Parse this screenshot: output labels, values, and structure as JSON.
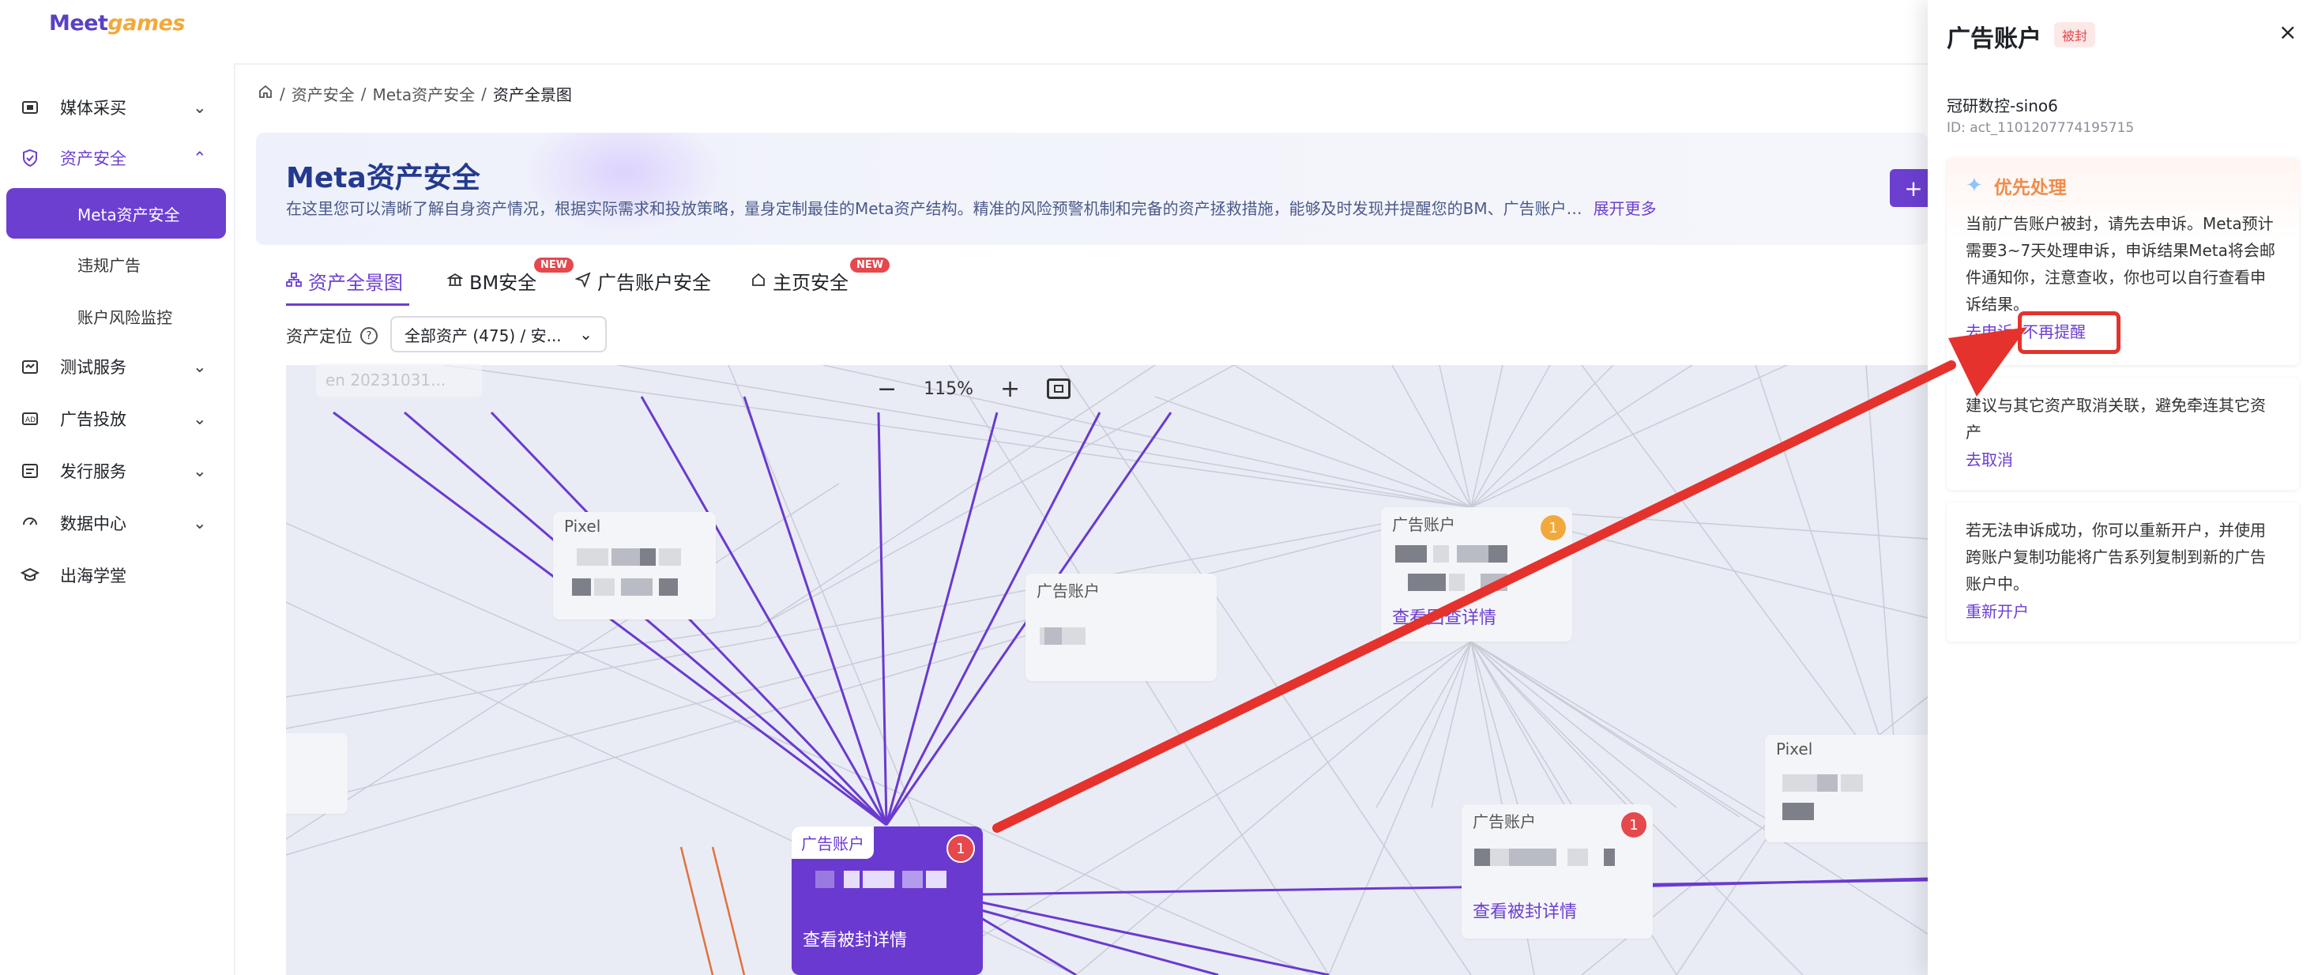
{
  "app": {
    "logo_part1": "Meet",
    "logo_part2": "games"
  },
  "sidebar": {
    "items": [
      {
        "label": "媒体采买",
        "icon": "media-icon"
      },
      {
        "label": "资产安全",
        "icon": "shield-icon"
      },
      {
        "label": "测试服务",
        "icon": "test-icon"
      },
      {
        "label": "广告投放",
        "icon": "ad-icon"
      },
      {
        "label": "发行服务",
        "icon": "publish-icon"
      },
      {
        "label": "数据中心",
        "icon": "data-icon"
      },
      {
        "label": "出海学堂",
        "icon": "school-icon"
      }
    ],
    "sub_items": [
      "Meta资产安全",
      "违规广告",
      "账户风险监控"
    ]
  },
  "breadcrumb": {
    "items": [
      "资产安全",
      "Meta资产安全"
    ],
    "current": "资产全景图"
  },
  "banner": {
    "title": "Meta资产安全",
    "description": "在这里您可以清晰了解自身资产情况，根据实际需求和投放策略，量身定制最佳的Meta资产结构。精准的风险预警机制和完备的资产拯救措施，能够及时发现并提醒您的BM、广告账户…",
    "more": "展开更多",
    "button_plus": "+"
  },
  "tabs": [
    {
      "label": "资产全景图",
      "badge": ""
    },
    {
      "label": "BM安全",
      "badge": "NEW"
    },
    {
      "label": "广告账户安全",
      "badge": ""
    },
    {
      "label": "主页安全",
      "badge": "NEW"
    }
  ],
  "filter": {
    "label": "资产定位",
    "value": "全部资产 (475) / 安..."
  },
  "graph": {
    "zoom": "115%",
    "ghost_text": "en 20231031...",
    "nodes": [
      {
        "label": "Pixel"
      },
      {
        "label": "广告账户"
      },
      {
        "label": "广告账户",
        "badge": "1",
        "link": "查看回查详情"
      },
      {
        "label": "广告账户",
        "badge": "1",
        "link": "查看被封详情"
      },
      {
        "label": "广告账户",
        "badge": "1",
        "link": "查看被封详情"
      },
      {
        "label": "Pixel"
      }
    ]
  },
  "drawer": {
    "title": "广告账户",
    "status": "被封",
    "close": "×",
    "account_name": "冠研数控-sino6",
    "account_id": "ID: act_1101207774195715",
    "priority": {
      "title": "优先处理",
      "text": "当前广告账户被封，请先去申诉。Meta预计需要3~7天处理申诉，申诉结果Meta将会邮件通知你，注意查收，你也可以自行查看申诉结果。",
      "action1": "去申诉",
      "action2": "不再提醒"
    },
    "cancel_card": {
      "text": "建议与其它资产取消关联，避免牵连其它资产",
      "action": "去取消"
    },
    "reopen_card": {
      "text": "若无法申诉成功，你可以重新开户，并使用跨账户复制功能将广告系列复制到新的广告账户中。",
      "action": "重新开户"
    }
  },
  "colors": {
    "accent": "#6c3fd1",
    "danger": "#e5484d",
    "priority": "#f28b4a",
    "annotation": "#e5322d"
  }
}
